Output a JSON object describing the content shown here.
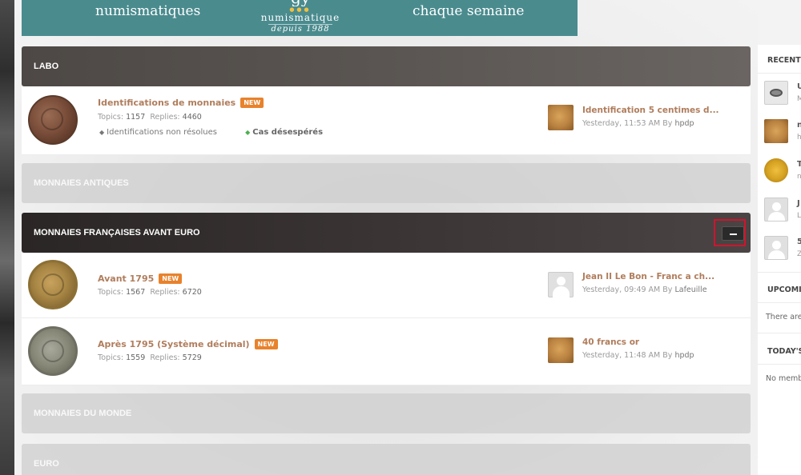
{
  "banner": {
    "left_text": "numismatiques",
    "center_logo": "gy",
    "center_name": "numismatique",
    "center_since": "depuis 1988",
    "right_text": "chaque semaine"
  },
  "categories": [
    {
      "label": "LABO"
    },
    {
      "label": "MONNAIES ANTIQUES"
    },
    {
      "label": "MONNAIES FRANÇAISES AVANT EURO"
    },
    {
      "label": "MONNAIES DU MONDE"
    },
    {
      "label": "EURO"
    }
  ],
  "forums": [
    {
      "title": "Identifications de monnaies",
      "badge": "NEW",
      "topics_label": "Topics:",
      "topics": "1157",
      "replies_label": "Replies:",
      "replies": "4460",
      "subforums": [
        "Identifications non résolues",
        "Cas désespérés"
      ],
      "last_title": "Identification 5 centimes d...",
      "last_time": "Yesterday, 11:53 AM",
      "last_by": "By",
      "last_user": "hpdp"
    },
    {
      "title": "Avant 1795",
      "badge": "NEW",
      "topics_label": "Topics:",
      "topics": "1567",
      "replies_label": "Replies:",
      "replies": "6720",
      "last_title": "Jean II Le Bon - Franc a ch...",
      "last_time": "Yesterday, 09:49 AM",
      "last_by": "By",
      "last_user": "Lafeuille"
    },
    {
      "title": "Après 1795 (Système décimal)",
      "badge": "NEW",
      "topics_label": "Topics:",
      "topics": "1559",
      "replies_label": "Replies:",
      "replies": "5729",
      "last_title": "40 francs or",
      "last_time": "Yesterday, 11:48 AM",
      "last_by": "By",
      "last_user": "hpdp"
    }
  ],
  "sidebar": {
    "recent_title": "RECENT",
    "recent_items": [
      {
        "letter": "U",
        "sub": "M"
      },
      {
        "letter": "n",
        "sub": "h"
      },
      {
        "letter": "T",
        "sub": "n"
      },
      {
        "letter": "J",
        "sub": "L"
      },
      {
        "letter": "5",
        "sub": "Z"
      }
    ],
    "upcoming_title": "UPCOMI",
    "upcoming_text": "There are",
    "today_title": "TODAY'S",
    "today_text": "No memb"
  },
  "colors": {
    "accent_link": "#b07d5c",
    "badge": "#e8822c",
    "banner": "#4a8b8e",
    "highlight_border": "#d0142c"
  }
}
